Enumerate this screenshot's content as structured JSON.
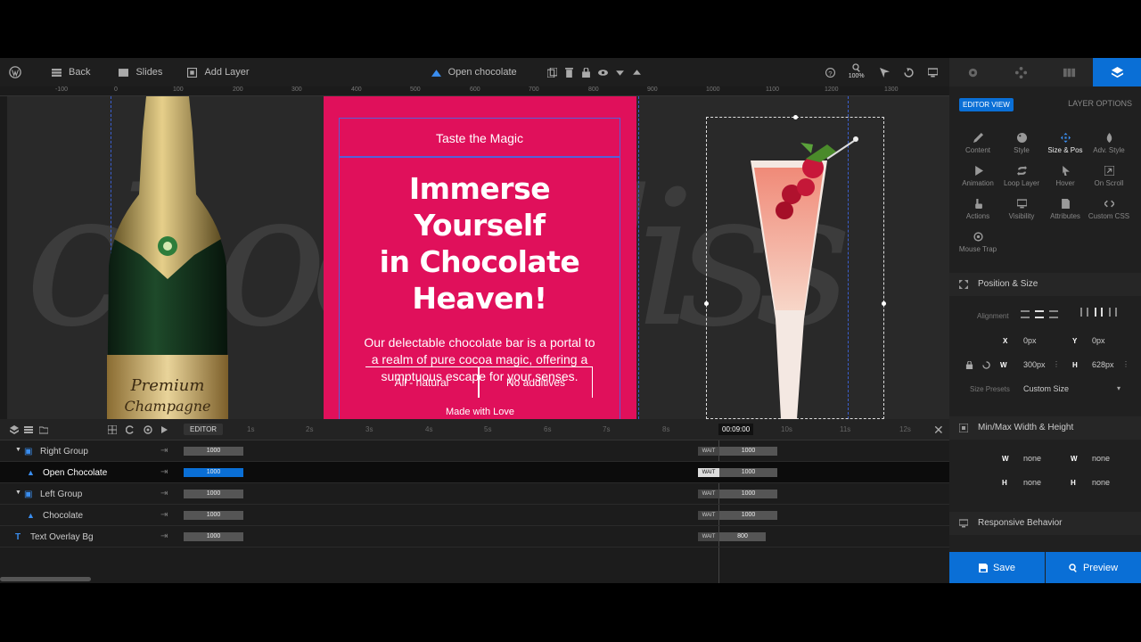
{
  "toolbar": {
    "back_label": "Back",
    "slides_label": "Slides",
    "add_layer_label": "Add Layer",
    "current_layer": "Open chocolate",
    "zoom": "100%"
  },
  "ruler": {
    "ticks": [
      "-100",
      "0",
      "100",
      "200",
      "300",
      "400",
      "500",
      "600",
      "700",
      "800",
      "900",
      "1000",
      "1100",
      "1200",
      "1300"
    ]
  },
  "canvas": {
    "bg_text": "chocobliss",
    "bottle_label_1": "Premium",
    "bottle_label_2": "Champagne"
  },
  "slide": {
    "tagline": "Taste the Magic",
    "headline_1": "Immerse Yourself",
    "headline_2": "in Chocolate",
    "headline_3": "Heaven!",
    "paragraph": "Our delectable chocolate bar is a portal to a realm of pure cocoa magic, offering a sumptuous escape for your senses.",
    "pill_1": "All - natural",
    "pill_2": "No additives",
    "made_with": "Made with Love",
    "bg_color": "#e0105b"
  },
  "timeline": {
    "editor_label": "EDITOR",
    "seconds": [
      "1s",
      "2s",
      "3s",
      "4s",
      "5s",
      "6s",
      "7s",
      "8s",
      "10s",
      "11s",
      "12s"
    ],
    "current_time": "00:09:00",
    "rows": [
      {
        "name": "Right Group",
        "duration": "1000",
        "wait": "WAIT",
        "wait_value": "1000"
      },
      {
        "name": "Open Chocolate",
        "duration": "1000",
        "wait": "WAIT",
        "wait_value": "1000"
      },
      {
        "name": "Left Group",
        "duration": "1000",
        "wait": "WAIT",
        "wait_value": "1000"
      },
      {
        "name": "Chocolate",
        "duration": "1000",
        "wait": "WAIT",
        "wait_value": "1000"
      },
      {
        "name": "Text Overlay Bg",
        "duration": "1000",
        "wait": "WAIT",
        "wait_value": "800"
      }
    ]
  },
  "panel": {
    "editor_view": "EDITOR VIEW",
    "layer_options": "LAYER OPTIONS",
    "options": [
      "Content",
      "Style",
      "Size & Pos",
      "Adv. Style",
      "Animation",
      "Loop Layer",
      "Hover",
      "On Scroll",
      "Actions",
      "Visibility",
      "Attributes",
      "Custom CSS",
      "Mouse Trap"
    ],
    "position_size_title": "Position & Size",
    "alignment_label": "Alignment",
    "x_label": "X",
    "x_value": "0px",
    "y_label": "Y",
    "y_value": "0px",
    "w_label": "W",
    "w_value": "300px",
    "h_label": "H",
    "h_value": "628px",
    "size_presets_label": "Size Presets",
    "size_presets_value": "Custom Size",
    "minmax_title": "Min/Max Width & Height",
    "min_w": "none",
    "max_w": "none",
    "min_h": "none",
    "max_h": "none",
    "responsive_title": "Responsive Behavior",
    "save_label": "Save",
    "preview_label": "Preview"
  },
  "colors": {
    "accent": "#0a6fd6",
    "slide_bg": "#e0105b"
  }
}
